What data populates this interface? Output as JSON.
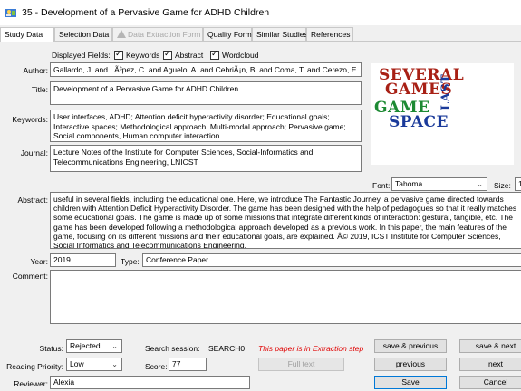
{
  "window": {
    "title": "35 - Development of a Pervasive Game for ADHD Children"
  },
  "tabs": [
    {
      "label": "Study Data"
    },
    {
      "label": "Selection Data"
    },
    {
      "label": "Data Extraction Form"
    },
    {
      "label": "Quality Form"
    },
    {
      "label": "Similar Studies"
    },
    {
      "label": "References"
    }
  ],
  "displayed_fields": {
    "label": "Displayed Fields:",
    "keywords": "Keywords",
    "abstract": "Abstract",
    "wordcloud": "Wordcloud"
  },
  "author": {
    "label": "Author:",
    "value": "Gallardo, J. and LÃ³pez, C. and Aguelo, A. and CebriÃ¡n, B. and Coma, T. and Cerezo, E."
  },
  "title": {
    "label": "Title:",
    "value": "Development of a Pervasive Game for ADHD Children"
  },
  "keywords": {
    "label": "Keywords:",
    "value": "User interfaces, ADHD;  Attention deficit hyperactivity disorder;  Educational goals;  Interactive spaces;  Methodological approach;  Multi-modal approach;  Pervasive game;  Social components, Human computer interaction"
  },
  "journal": {
    "label": "Journal:",
    "value": "Lecture Notes of the Institute for Computer Sciences, Social-Informatics and Telecommunications Engineering, LNICST"
  },
  "wordcloud_image": {
    "lines": [
      "SEVERAL",
      "GAMES",
      "GAME",
      "SPACE",
      "LAST"
    ]
  },
  "font": {
    "label": "Font:",
    "value": "Tahoma",
    "size_label": "Size:",
    "size_value": "1"
  },
  "abstract": {
    "label": "Abstract:",
    "value": "useful in several fields, including the educational one. Here, we introduce The Fantastic Journey, a pervasive game directed towards children with Attention Deficit Hyperactivity Disorder. The game has been designed with the help of pedagogues so that it really matches some educational goals. The game is made up of some missions that integrate different kinds of interaction: gestural, tangible, etc. The game has been developed following a methodological approach developed as a previous work. In this paper, the main features of the game, focusing on its different missions and their educational goals, are explained. Â© 2019, ICST Institute for Computer Sciences, Social Informatics and Telecommunications Engineering."
  },
  "year": {
    "label": "Year:",
    "value": "2019"
  },
  "type": {
    "label": "Type:",
    "value": "Conference Paper"
  },
  "comment": {
    "label": "Comment:",
    "value": ""
  },
  "status": {
    "label": "Status:",
    "value": "Rejected"
  },
  "search_session": {
    "label": "Search session:",
    "value": "SEARCH0"
  },
  "extraction_msg": "This paper is in Extraction step",
  "reading_priority": {
    "label": "Reading Priority:",
    "value": "Low"
  },
  "score": {
    "label": "Score:",
    "value": "77"
  },
  "reviewer": {
    "label": "Reviewer:",
    "value": "Alexia"
  },
  "buttons": {
    "save_previous": "save & previous",
    "save_next": "save & next",
    "full_text": "Full text",
    "previous": "previous",
    "next": "next",
    "save": "Save",
    "cancel": "Cancel"
  },
  "colors": {
    "logo_red": "#a82015",
    "logo_green": "#1d8a33",
    "logo_blue": "#1a3a9a",
    "alert": "#e00000"
  }
}
